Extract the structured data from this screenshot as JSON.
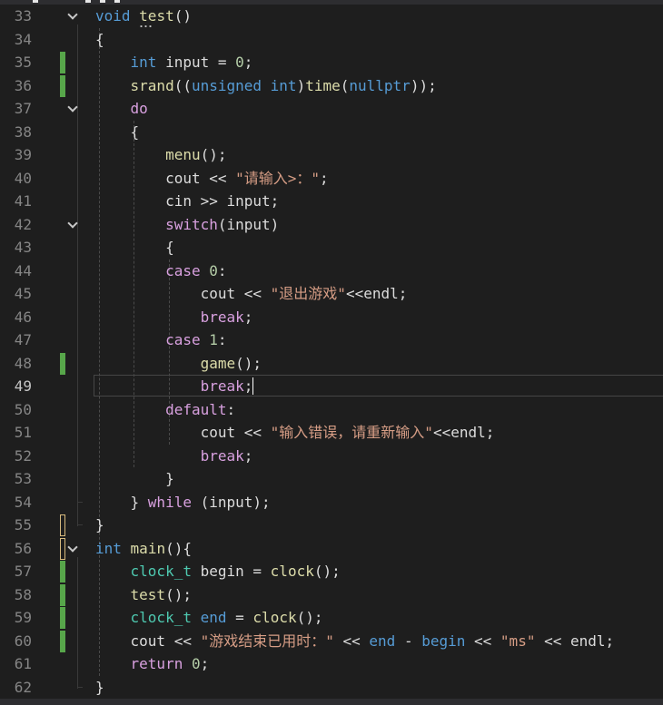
{
  "colors": {
    "background": "#1e1e1e",
    "line_number": "#858585",
    "line_number_active": "#c6c6c6",
    "keyword": "#569cd6",
    "control": "#d8a0df",
    "string": "#d69d85",
    "function": "#dcdcaa",
    "type": "#4ec9b0",
    "number": "#b5cea8",
    "default": "#dcdcdc",
    "changed": "#57a64a",
    "unsaved": "#d7ba7d"
  },
  "editor": {
    "active_line": 49,
    "lines": [
      {
        "n": "33",
        "fold": true,
        "tokens": [
          {
            "t": "void",
            "c": "keyword"
          },
          {
            "t": " "
          },
          {
            "t": "test",
            "c": "function"
          },
          {
            "t": "()"
          }
        ]
      },
      {
        "n": "34",
        "tokens": [
          {
            "t": "{"
          }
        ]
      },
      {
        "n": "35",
        "mark": "changed",
        "tokens": [
          {
            "t": "    "
          },
          {
            "t": "int",
            "c": "keyword"
          },
          {
            "t": " input = "
          },
          {
            "t": "0",
            "c": "number"
          },
          {
            "t": ";"
          }
        ]
      },
      {
        "n": "36",
        "mark": "changed",
        "tokens": [
          {
            "t": "    "
          },
          {
            "t": "srand",
            "c": "function"
          },
          {
            "t": "(("
          },
          {
            "t": "unsigned int",
            "c": "keyword"
          },
          {
            "t": ")"
          },
          {
            "t": "time",
            "c": "function"
          },
          {
            "t": "("
          },
          {
            "t": "nullptr",
            "c": "keyword"
          },
          {
            "t": "));"
          }
        ]
      },
      {
        "n": "37",
        "fold": true,
        "tokens": [
          {
            "t": "    "
          },
          {
            "t": "do",
            "c": "control"
          }
        ]
      },
      {
        "n": "38",
        "tokens": [
          {
            "t": "    {"
          }
        ]
      },
      {
        "n": "39",
        "tokens": [
          {
            "t": "        "
          },
          {
            "t": "menu",
            "c": "function"
          },
          {
            "t": "();"
          }
        ]
      },
      {
        "n": "40",
        "tokens": [
          {
            "t": "        cout << "
          },
          {
            "t": "\"请输入>：\"",
            "c": "string"
          },
          {
            "t": ";"
          }
        ]
      },
      {
        "n": "41",
        "tokens": [
          {
            "t": "        cin >> input;"
          }
        ]
      },
      {
        "n": "42",
        "fold": true,
        "tokens": [
          {
            "t": "        "
          },
          {
            "t": "switch",
            "c": "control"
          },
          {
            "t": "(input)"
          }
        ]
      },
      {
        "n": "43",
        "tokens": [
          {
            "t": "        {"
          }
        ]
      },
      {
        "n": "44",
        "tokens": [
          {
            "t": "        "
          },
          {
            "t": "case",
            "c": "control"
          },
          {
            "t": " "
          },
          {
            "t": "0",
            "c": "number"
          },
          {
            "t": ":"
          }
        ]
      },
      {
        "n": "45",
        "tokens": [
          {
            "t": "            cout << "
          },
          {
            "t": "\"退出游戏\"",
            "c": "string"
          },
          {
            "t": "<<endl;"
          }
        ]
      },
      {
        "n": "46",
        "tokens": [
          {
            "t": "            "
          },
          {
            "t": "break",
            "c": "control"
          },
          {
            "t": ";"
          }
        ]
      },
      {
        "n": "47",
        "tokens": [
          {
            "t": "        "
          },
          {
            "t": "case",
            "c": "control"
          },
          {
            "t": " "
          },
          {
            "t": "1",
            "c": "number"
          },
          {
            "t": ":"
          }
        ]
      },
      {
        "n": "48",
        "mark": "changed",
        "tokens": [
          {
            "t": "            "
          },
          {
            "t": "game",
            "c": "function"
          },
          {
            "t": "();"
          }
        ]
      },
      {
        "n": "49",
        "tokens": [
          {
            "t": "            "
          },
          {
            "t": "break",
            "c": "control"
          },
          {
            "t": ";"
          }
        ]
      },
      {
        "n": "50",
        "tokens": [
          {
            "t": "        "
          },
          {
            "t": "default",
            "c": "control"
          },
          {
            "t": ":"
          }
        ]
      },
      {
        "n": "51",
        "tokens": [
          {
            "t": "            cout << "
          },
          {
            "t": "\"输入错误，请重新输入\"",
            "c": "string"
          },
          {
            "t": "<<endl;"
          }
        ]
      },
      {
        "n": "52",
        "tokens": [
          {
            "t": "            "
          },
          {
            "t": "break",
            "c": "control"
          },
          {
            "t": ";"
          }
        ]
      },
      {
        "n": "53",
        "tokens": [
          {
            "t": "        }"
          }
        ]
      },
      {
        "n": "54",
        "tokens": [
          {
            "t": "    } "
          },
          {
            "t": "while",
            "c": "control"
          },
          {
            "t": " (input);"
          }
        ]
      },
      {
        "n": "55",
        "mark": "unsaved",
        "tokens": [
          {
            "t": "}"
          }
        ]
      },
      {
        "n": "56",
        "mark": "unsaved",
        "fold": true,
        "tokens": [
          {
            "t": "int",
            "c": "keyword"
          },
          {
            "t": " "
          },
          {
            "t": "main",
            "c": "function"
          },
          {
            "t": "(){"
          }
        ]
      },
      {
        "n": "57",
        "mark": "changed",
        "tokens": [
          {
            "t": "    "
          },
          {
            "t": "clock_t",
            "c": "type"
          },
          {
            "t": " begin = "
          },
          {
            "t": "clock",
            "c": "function"
          },
          {
            "t": "();"
          }
        ]
      },
      {
        "n": "58",
        "mark": "changed",
        "tokens": [
          {
            "t": "    "
          },
          {
            "t": "test",
            "c": "function"
          },
          {
            "t": "();"
          }
        ]
      },
      {
        "n": "59",
        "mark": "changed",
        "tokens": [
          {
            "t": "    "
          },
          {
            "t": "clock_t",
            "c": "type"
          },
          {
            "t": " "
          },
          {
            "t": "end",
            "c": "keyword"
          },
          {
            "t": " = "
          },
          {
            "t": "clock",
            "c": "function"
          },
          {
            "t": "();"
          }
        ]
      },
      {
        "n": "60",
        "mark": "changed",
        "tokens": [
          {
            "t": "    cout << "
          },
          {
            "t": "\"游戏结束已用时：\"",
            "c": "string"
          },
          {
            "t": " << "
          },
          {
            "t": "end",
            "c": "keyword"
          },
          {
            "t": " - "
          },
          {
            "t": "begin",
            "c": "keyword"
          },
          {
            "t": " << "
          },
          {
            "t": "\"ms\"",
            "c": "string"
          },
          {
            "t": " << endl;"
          }
        ]
      },
      {
        "n": "61",
        "tokens": [
          {
            "t": "    "
          },
          {
            "t": "return",
            "c": "control"
          },
          {
            "t": " "
          },
          {
            "t": "0",
            "c": "number"
          },
          {
            "t": ";"
          }
        ]
      },
      {
        "n": "62",
        "tokens": [
          {
            "t": "}"
          }
        ]
      }
    ]
  }
}
